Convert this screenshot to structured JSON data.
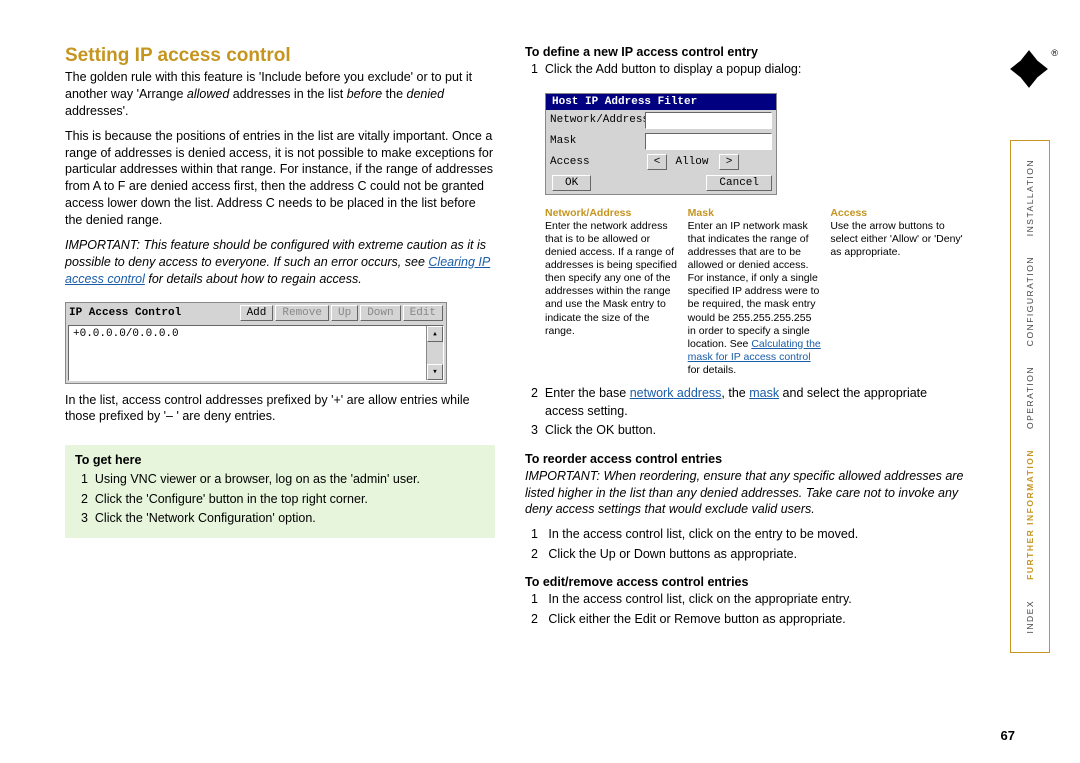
{
  "page_number": "67",
  "title": "Setting IP access control",
  "intro": {
    "p1a": "The golden rule with this feature is 'Include before you exclude' or to put it another way 'Arrange ",
    "p1_allowed": "allowed",
    "p1b": " addresses in the list ",
    "p1_before": "before",
    "p1c": " the ",
    "p1_denied": "denied",
    "p1d": " addresses'.",
    "p2": "This is because the positions of entries in the list are vitally important. Once a range of addresses is denied access, it is not possible to make exceptions for particular addresses within that range. For instance, if the range of addresses from A to F are denied access first, then the address C could not be granted access lower down the list. Address C needs to be placed in the list before the denied range.",
    "important_a": "IMPORTANT: This feature should be configured with extreme caution as it is possible to deny access to everyone. If such an error occurs, see ",
    "important_link": "Clearing IP access control",
    "important_b": " for details about how to regain access.",
    "p3": "In the list, access control addresses prefixed by '+' are allow entries while those prefixed by '– ' are deny entries."
  },
  "ip_control_widget": {
    "title": "IP Access Control",
    "buttons": {
      "add": "Add",
      "remove": "Remove",
      "up": "Up",
      "down": "Down",
      "edit": "Edit"
    },
    "entry": "+0.0.0.0/0.0.0.0"
  },
  "get_here": {
    "title": "To get here",
    "items": [
      "Using VNC viewer or a browser, log on as the 'admin' user.",
      "Click the 'Configure' button in the top right corner.",
      "Click the 'Network Configuration' option."
    ]
  },
  "right": {
    "define_title": "To define a new IP access control entry",
    "define_step1": "Click the Add button to display a popup dialog:",
    "host_filter": {
      "title": "Host IP Address Filter",
      "network_label": "Network/Address",
      "mask_label": "Mask",
      "access_label": "Access",
      "allow_value": "Allow",
      "ok": "OK",
      "cancel": "Cancel"
    },
    "col_net": {
      "h": "Network/Address",
      "t": "Enter the network address that is to be allowed or denied access. If a range of addresses is being specified then specify any one of the addresses within the range and use the Mask entry to indicate the size of the range."
    },
    "col_mask": {
      "h": "Mask",
      "t": "Enter an IP network mask that indicates the range of addresses that are to be allowed or denied access. For instance, if only a single specified IP address were to be required, the mask entry would be 255.255.255.255 in order to specify a single location. See ",
      "link": "Calculating the mask for IP access control",
      "t2": " for details."
    },
    "col_access": {
      "h": "Access",
      "t": "Use the arrow buttons to select either 'Allow' or 'Deny' as appropriate."
    },
    "define_step2a": "Enter the base ",
    "define_step2_link1": "network address",
    "define_step2b": ", the ",
    "define_step2_link2": "mask",
    "define_step2c": " and select the appropriate access setting.",
    "define_step3": "Click the OK button.",
    "reorder_title": "To reorder access control entries",
    "reorder_important": "IMPORTANT: When reordering, ensure that any specific allowed addresses are listed higher in the list than any denied addresses. Take care not to invoke any deny access settings that would exclude valid users.",
    "reorder_1": "In the access control list, click on the entry to be moved.",
    "reorder_2": "Click the Up or Down buttons as appropriate.",
    "edit_title": "To edit/remove access control entries",
    "edit_1": "In the access control list, click on the appropriate entry.",
    "edit_2": "Click either the Edit or Remove button as appropriate."
  },
  "sidenav": {
    "items": [
      "INSTALLATION",
      "CONFIGURATION",
      "OPERATION",
      "FURTHER INFORMATION",
      "INDEX"
    ],
    "active_index": 3
  },
  "reg_mark": "®"
}
